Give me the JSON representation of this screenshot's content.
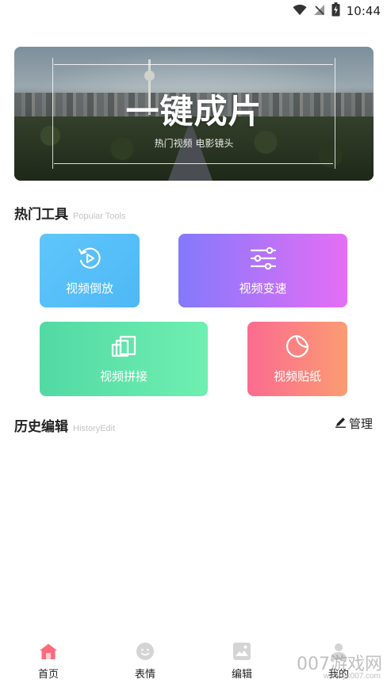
{
  "status_bar": {
    "time": "10:44"
  },
  "banner": {
    "title": "一键成片",
    "subtitle": "热门视频 电影镜头"
  },
  "popular": {
    "title": "热门工具",
    "subtitle": "Popular Tools"
  },
  "tools": [
    {
      "label": "视频倒放",
      "icon": "reverse-play-icon"
    },
    {
      "label": "视频变速",
      "icon": "sliders-icon"
    },
    {
      "label": "视频拼接",
      "icon": "stack-icon"
    },
    {
      "label": "视频贴纸",
      "icon": "sticker-icon"
    }
  ],
  "history": {
    "title": "历史编辑",
    "subtitle": "HistoryEdit",
    "manage_label": "管理"
  },
  "nav": [
    {
      "label": "首页",
      "icon": "home-icon",
      "active": true,
      "color": "#fb6b7c"
    },
    {
      "label": "表情",
      "icon": "smiley-icon",
      "active": false,
      "color": "#cfcfcf"
    },
    {
      "label": "编辑",
      "icon": "image-edit-icon",
      "active": false,
      "color": "#cfcfcf"
    },
    {
      "label": "我的",
      "icon": "person-icon",
      "active": false,
      "color": "#cfcfcf"
    }
  ],
  "watermark": {
    "brand": "007游戏网",
    "url": "www.yx007.com"
  }
}
